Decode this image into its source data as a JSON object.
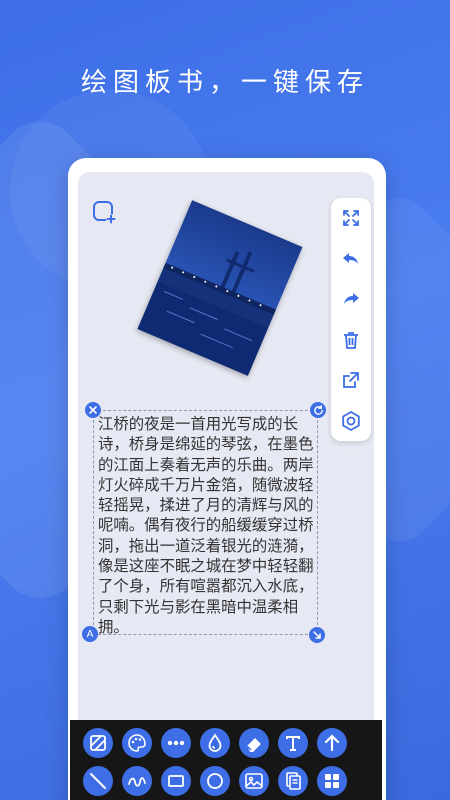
{
  "headline": "绘图板书，一键保存",
  "poem": "江桥的夜是一首用光写成的长诗，桥身是绵延的琴弦，在墨色的江面上奏着无声的乐曲。两岸灯火碎成千万片金箔，随微波轻轻摇晃，揉进了月的清辉与风的呢喃。偶有夜行的船缓缓穿过桥洞，拖出一道泛着银光的涟漪，像是这座不眠之城在梦中轻轻翻了个身，所有喧嚣都沉入水底，只剩下光与影在黑暗中温柔相拥。",
  "handles": {
    "text_style_label": "A"
  },
  "right_toolbar": [
    "fullscreen-icon",
    "undo-icon",
    "redo-icon",
    "delete-icon",
    "export-icon",
    "settings-icon"
  ],
  "bottom_tools_row1": [
    "fill-icon",
    "palette-icon",
    "more-icon",
    "ink-drop-icon",
    "eraser-icon",
    "text-icon",
    "arrow-icon"
  ],
  "bottom_tools_row2": [
    "line-icon",
    "curve-icon",
    "rectangle-icon",
    "circle-icon",
    "image-icon",
    "document-icon",
    "grid-icon"
  ],
  "colors": {
    "accent": "#3d6ee6",
    "canvas": "#e6e9f3",
    "bar": "#161616"
  }
}
